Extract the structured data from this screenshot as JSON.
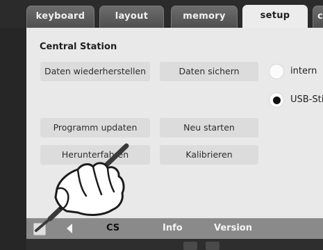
{
  "tabs": [
    {
      "label": "keyboard"
    },
    {
      "label": "layout"
    },
    {
      "label": "memory"
    },
    {
      "label": "setup"
    },
    {
      "label": "co"
    }
  ],
  "panel": {
    "title": "Central Station",
    "buttons": {
      "restore": "Daten wiederherstellen",
      "backup": "Daten sichern",
      "update": "Programm updaten",
      "restart": "Neu starten",
      "shutdown": "Herunterfahren",
      "calibrate": "Kalibrieren"
    },
    "storage": {
      "intern": "intern",
      "usb": "USB-Sti",
      "selected": "usb"
    }
  },
  "navbar": {
    "cs": "CS",
    "info": "Info",
    "version": "Version"
  },
  "overlay_icon": "hand-with-stylus-icon"
}
